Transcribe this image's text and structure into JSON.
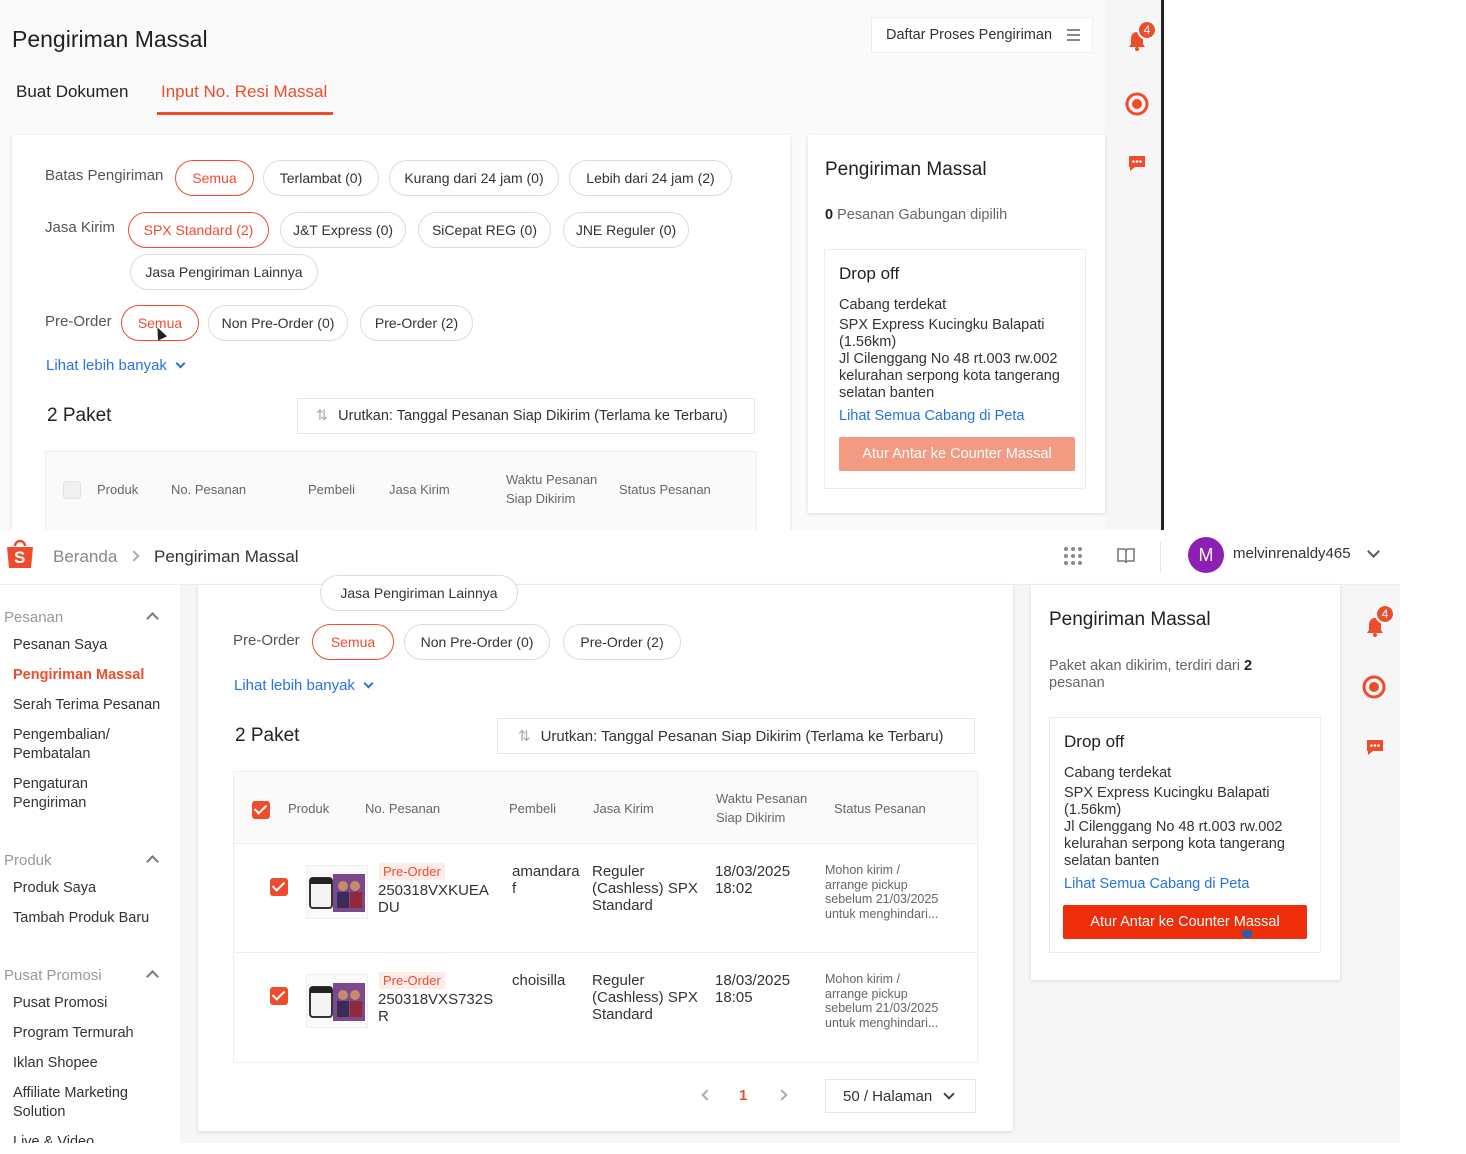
{
  "top": {
    "title": "Pengiriman Massal",
    "process_list_button": "Daftar Proses Pengiriman",
    "tabs": [
      "Buat Dokumen",
      "Input No. Resi Massal"
    ],
    "notif_count": "4",
    "filters": {
      "batas_label": "Batas Pengiriman",
      "batas": [
        "Semua",
        "Terlambat (0)",
        "Kurang dari 24 jam (0)",
        "Lebih dari 24 jam (2)"
      ],
      "jasa_label": "Jasa Kirim",
      "jasa": [
        "SPX Standard (2)",
        "J&T Express (0)",
        "SiCepat REG (0)",
        "JNE Reguler (0)",
        "Jasa Pengiriman Lainnya"
      ],
      "preorder_label": "Pre-Order",
      "preorder": [
        "Semua",
        "Non Pre-Order (0)",
        "Pre-Order (2)"
      ]
    },
    "see_more": "Lihat lebih banyak",
    "paket_count": "2 Paket",
    "sort": "Urutkan: Tanggal Pesanan Siap Dikirim (Terlama ke Terbaru)",
    "table_headers": [
      "Produk",
      "No. Pesanan",
      "Pembeli",
      "Jasa Kirim",
      "Waktu Pesanan Siap Dikirim",
      "Status Pesanan"
    ],
    "panel": {
      "title": "Pengiriman Massal",
      "selected_count": "0",
      "selected_text": "Pesanan Gabungan dipilih",
      "dropoff_title": "Drop off",
      "branch_label": "Cabang terdekat",
      "branch_name": "SPX Express Kucingku Balapati (1.56km)",
      "branch_address": "Jl Cilenggang No 48 rt.003 rw.002 kelurahan serpong kota tangerang selatan banten",
      "map_link": "Lihat Semua Cabang di Peta",
      "action_button": "Atur Antar ke Counter Massal"
    }
  },
  "bottom": {
    "breadcrumb": {
      "home": "Beranda",
      "current": "Pengiriman Massal"
    },
    "user": {
      "initial": "M",
      "name": "melvinrenaldy465"
    },
    "notif_count": "4",
    "sidebar": {
      "sections": [
        {
          "title": "Pesanan",
          "items": [
            "Pesanan Saya",
            "Pengiriman Massal",
            "Serah Terima Pesanan",
            "Pengembalian/ Pembatalan",
            "Pengaturan Pengiriman"
          ]
        },
        {
          "title": "Produk",
          "items": [
            "Produk Saya",
            "Tambah Produk Baru"
          ]
        },
        {
          "title": "Pusat Promosi",
          "items": [
            "Pusat Promosi",
            "Program Termurah",
            "Iklan Shopee",
            "Affiliate Marketing Solution",
            "Live & Video"
          ]
        }
      ]
    },
    "filters": {
      "jasa_other": "Jasa Pengiriman Lainnya",
      "preorder_label": "Pre-Order",
      "preorder": [
        "Semua",
        "Non Pre-Order (0)",
        "Pre-Order (2)"
      ]
    },
    "see_more": "Lihat lebih banyak",
    "paket_count": "2 Paket",
    "sort": "Urutkan: Tanggal Pesanan Siap Dikirim (Terlama ke Terbaru)",
    "table_headers": [
      "Produk",
      "No. Pesanan",
      "Pembeli",
      "Jasa Kirim",
      "Waktu Pesanan Siap Dikirim",
      "Status Pesanan"
    ],
    "orders": [
      {
        "tag": "Pre-Order",
        "order_no": "250318VXKUEADU",
        "buyer": "amandaraf",
        "shipping": "Reguler (Cashless) SPX Standard",
        "date": "18/03/2025",
        "time": "18:02",
        "status": "Mohon kirim / arrange pickup sebelum 21/03/2025 untuk menghindari..."
      },
      {
        "tag": "Pre-Order",
        "order_no": "250318VXS732SR",
        "buyer": "choisilla",
        "shipping": "Reguler (Cashless) SPX Standard",
        "date": "18/03/2025",
        "time": "18:05",
        "status": "Mohon kirim / arrange pickup sebelum 21/03/2025 untuk menghindari..."
      }
    ],
    "pagination": {
      "page": "1",
      "per_page": "50 / Halaman"
    },
    "panel": {
      "title": "Pengiriman Massal",
      "summary_prefix": "Paket akan dikirim, terdiri dari",
      "summary_count": "2",
      "summary_suffix": "pesanan",
      "dropoff_title": "Drop off",
      "branch_label": "Cabang terdekat",
      "branch_name": "SPX Express Kucingku Balapati (1.56km)",
      "branch_address": "Jl Cilenggang No 48 rt.003 rw.002 kelurahan serpong kota tangerang selatan banten",
      "map_link": "Lihat Semua Cabang di Peta",
      "action_button": "Atur Antar ke Counter Massal"
    }
  },
  "colors": {
    "accent": "#ee4d2d",
    "link": "#2673dd",
    "muted_button": "#f29a82"
  }
}
